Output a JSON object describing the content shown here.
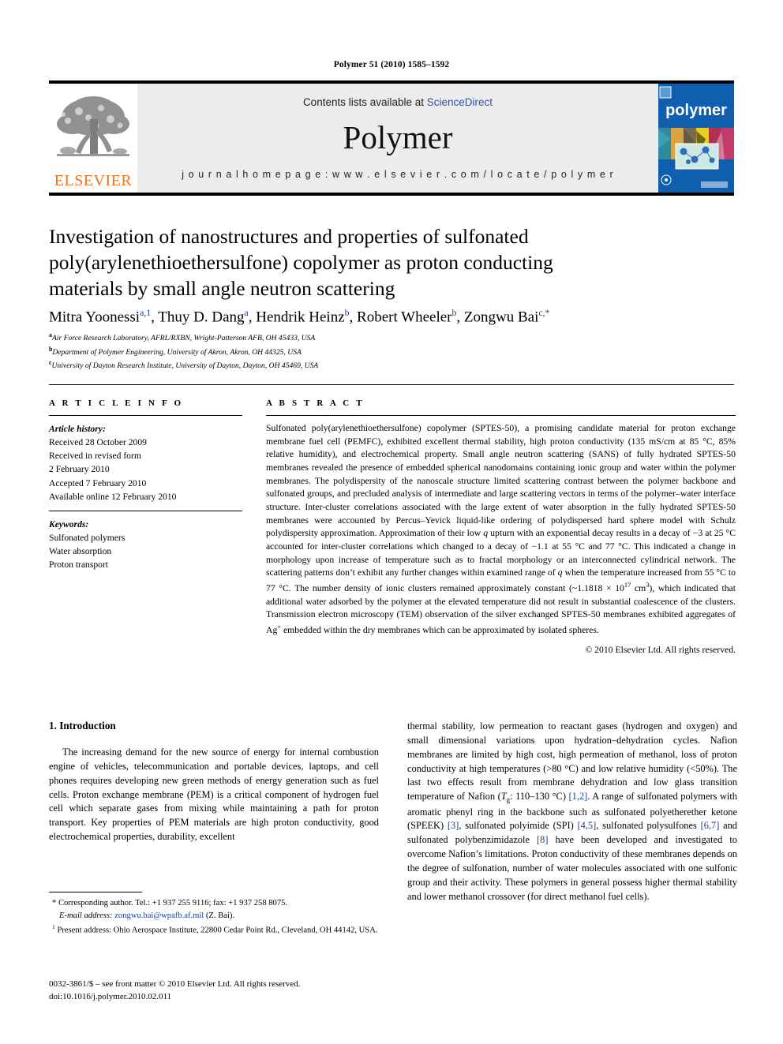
{
  "running_head": "Polymer 51 (2010) 1585–1592",
  "masthead": {
    "elsevier_wordmark": "ELSEVIER",
    "contents_prefix": "Contents lists available at ",
    "contents_link": "ScienceDirect",
    "journal_name": "Polymer",
    "homepage_label": "j o u r n a l   h o m e p a g e :   w w w . e l s e v i e r . c o m / l o c a t e / p o l y m e r",
    "cover_title": "polymer",
    "link_color": "#2b55a6",
    "elsevier_orange": "#E87722",
    "cover_blue": "#1060b0"
  },
  "article": {
    "title": "Investigation of nanostructures and properties of sulfonated poly(arylenethioethersulfone) copolymer as proton conducting materials by small angle neutron scattering",
    "authors_html": "Mitra Yoonessi<sup>a,1</sup>, Thuy D. Dang<sup>a</sup>, Hendrik Heinz<sup>b</sup>, Robert Wheeler<sup>b</sup>, Zongwu Bai<sup>c,*</sup>",
    "affiliations": [
      {
        "marker": "a",
        "text": "Air Force Research Laboratory, AFRL/RXBN, Wright-Patterson AFB, OH 45433, USA"
      },
      {
        "marker": "b",
        "text": "Department of Polymer Engineering, University of Akron, Akron, OH 44325, USA"
      },
      {
        "marker": "c",
        "text": "University of Dayton Research Institute, University of Dayton, Dayton, OH 45469, USA"
      }
    ]
  },
  "article_info": {
    "heading": "A R T I C L E  I N F O",
    "history_label": "Article history:",
    "history": [
      "Received 28 October 2009",
      "Received in revised form",
      "2 February 2010",
      "Accepted 7 February 2010",
      "Available online 12 February 2010"
    ],
    "keywords_label": "Keywords:",
    "keywords": [
      "Sulfonated polymers",
      "Water absorption",
      "Proton transport"
    ]
  },
  "abstract": {
    "heading": "A B S T R A C T",
    "body_html": "Sulfonated poly(arylenethioethersulfone) copolymer (SPTES-50), a promising candidate material for proton exchange membrane fuel cell (PEMFC), exhibited excellent thermal stability, high proton conductivity (135 mS/cm at 85 &deg;C, 85% relative humidity), and electrochemical property. Small angle neutron scattering (SANS) of fully hydrated SPTES-50 membranes revealed the presence of embedded spherical nanodomains containing ionic group and water within the polymer membranes. The polydispersity of the nanoscale structure limited scattering contrast between the polymer backbone and sulfonated groups, and precluded analysis of intermediate and large scattering vectors in terms of the polymer&ndash;water interface structure. Inter-cluster correlations associated with the large extent of water absorption in the fully hydrated SPTES-50 membranes were accounted by Percus&ndash;Yevick liquid-like ordering of polydispersed hard sphere model with Schulz polydispersity approximation. Approximation of their low <i>q</i> upturn with an exponential decay results in a decay of &minus;3 at 25 &deg;C accounted for inter-cluster correlations which changed to a decay of &minus;1.1 at 55 &deg;C and 77 &deg;C. This indicated a change in morphology upon increase of temperature such as to fractal morphology or an interconnected cylindrical network. The scattering patterns don&rsquo;t exhibit any further changes within examined range of <i>q</i> when the temperature increased from 55 &deg;C to 77 &deg;C. The number density of ionic clusters remained approximately constant (~1.1818 &times; 10<sup>17</sup> cm<sup>3</sup>), which indicated that additional water adsorbed by the polymer at the elevated temperature did not result in substantial coalescence of the clusters. Transmission electron microscopy (TEM) observation of the silver exchanged SPTES-50 membranes exhibited aggregates of Ag<sup>+</sup> embedded within the dry membranes which can be approximated by isolated spheres.",
    "copyright": "© 2010 Elsevier Ltd. All rights reserved."
  },
  "introduction": {
    "section_number_title": "1. Introduction",
    "left_paragraph_html": "The increasing demand for the new source of energy for internal combustion engine of vehicles, telecommunication and portable devices, laptops, and cell phones requires developing new green methods of energy generation such as fuel cells. Proton exchange membrane (PEM) is a critical component of hydrogen fuel cell which separate gases from mixing while maintaining a path for proton transport. Key properties of PEM materials are high proton conductivity, good electrochemical properties, durability, excellent",
    "right_paragraph_html": "thermal stability, low permeation to reactant gases (hydrogen and oxygen) and small dimensional variations upon hydration&ndash;dehydration cycles. Nafion membranes are limited by high cost, high permeation of methanol, loss of proton conductivity at high temperatures (&gt;80 &deg;C) and low relative humidity (&lt;50%). The last two effects result from membrane dehydration and low glass transition temperature of Nafion (<i>T</i><sub>g</sub>: 110&ndash;130 &deg;C) <span class=\"cite\">[1,2]</span>. A range of sulfonated polymers with aromatic phenyl ring in the backbone such as sulfonated polyetherether ketone (SPEEK) <span class=\"cite\">[3]</span>, sulfonated polyimide (SPI) <span class=\"cite\">[4,5]</span>, sulfonated polysulfones <span class=\"cite\">[6,7]</span> and sulfonated polybenzimidazole <span class=\"cite\">[8]</span> have been developed and investigated to overcome Nafion&rsquo;s limitations. Proton conductivity of these membranes depends on the degree of sulfonation, number of water molecules associated with one sulfonic group and their activity. These polymers in general possess higher thermal stability and lower methanol crossover (for direct methanol fuel cells)."
  },
  "footnotes": {
    "corresponding_html": "* Corresponding author. Tel.: +1 937 255 9116; fax: +1 937 258 8075.",
    "email_label": "E-mail address:",
    "email": "zongwu.bai@wpafb.af.mil",
    "email_suffix": "(Z. Bai).",
    "present_address_html": "<sup>1</sup> Present address: Ohio Aerospace Institute, 22800 Cedar Point Rd., Cleveland, OH 44142, USA."
  },
  "footer": {
    "issn_line": "0032-3861/$ – see front matter © 2010 Elsevier Ltd. All rights reserved.",
    "doi_line": "doi:10.1016/j.polymer.2010.02.011"
  }
}
